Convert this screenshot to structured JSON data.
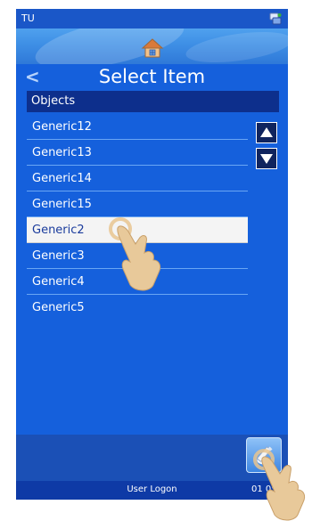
{
  "status": {
    "app_label": "TU",
    "system_icon": "network-icon"
  },
  "nav": {
    "home_icon": "home-icon",
    "back_icon": "back-chevron-icon"
  },
  "title": "Select Item",
  "list": {
    "header": "Objects",
    "items": [
      "Generic12",
      "Generic13",
      "Generic14",
      "Generic15",
      "Generic2",
      "Generic3",
      "Generic4",
      "Generic5"
    ],
    "selected": "Generic2"
  },
  "scroll": {
    "up_icon": "triangle-up-icon",
    "down_icon": "triangle-down-icon"
  },
  "action": {
    "icon": "edit-icon"
  },
  "footer": {
    "user_label": "User Logon",
    "time": "01 05"
  },
  "colors": {
    "screen_bg": "#1560dc",
    "header_bg": "#0d2f8c",
    "selected_bg": "#f4f4f4",
    "divider": "#6aa6f4"
  }
}
